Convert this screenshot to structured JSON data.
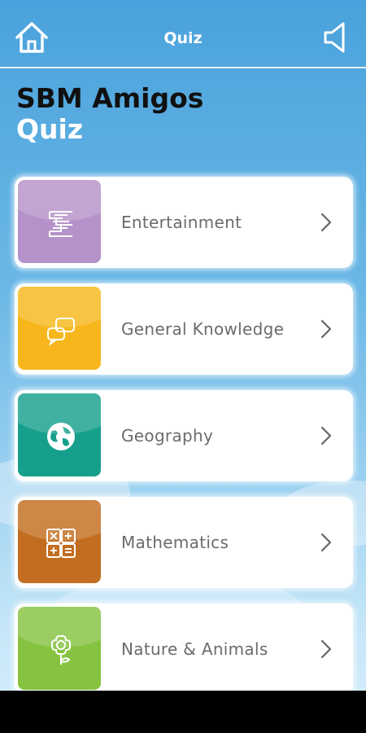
{
  "header": {
    "title": "Quiz",
    "home_icon": "home-icon",
    "sound_icon": "speaker-icon"
  },
  "heading": {
    "line1": "SBM Amigos",
    "line2": "Quiz"
  },
  "categories": [
    {
      "label": "Entertainment",
      "color": "#b592c9",
      "icon": "puzzle-icon"
    },
    {
      "label": "General Knowledge",
      "color": "#f7b71c",
      "icon": "chat-bubbles-icon"
    },
    {
      "label": "Geography",
      "color": "#16a08c",
      "icon": "globe-icon"
    },
    {
      "label": "Mathematics",
      "color": "#c26d1f",
      "icon": "calculator-icon"
    },
    {
      "label": "Nature & Animals",
      "color": "#86c341",
      "icon": "flower-icon"
    }
  ],
  "colors": {
    "background_top": "#4aa2dc",
    "background_bottom": "#d7eefb",
    "text_dark": "#111111",
    "label_gray": "#6b6b6b"
  }
}
